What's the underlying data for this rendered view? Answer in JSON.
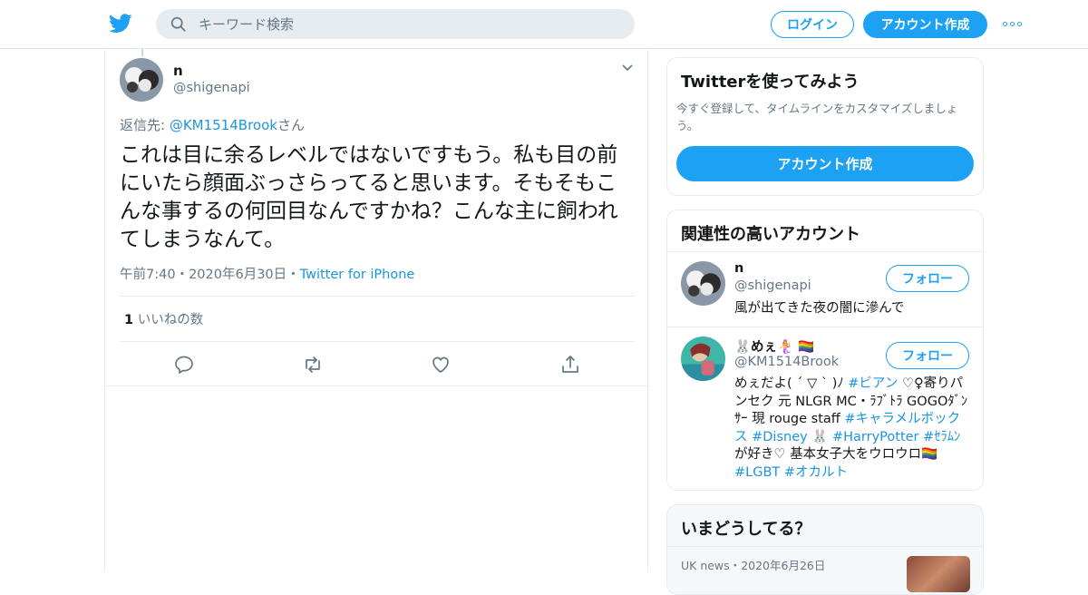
{
  "colors": {
    "accent": "#1da1f2",
    "link": "#1b95e0",
    "muted": "#657786"
  },
  "header": {
    "logo_icon": "twitter-bird-icon",
    "search_placeholder": "キーワード検索",
    "login_label": "ログイン",
    "signup_label": "アカウント作成",
    "more_icon": "more-dots-icon"
  },
  "tweet": {
    "author_name": "n",
    "author_handle": "@shigenapi",
    "reply_prefix": "返信先: ",
    "reply_handle": "@KM1514Brook",
    "reply_suffix": "さん",
    "text": "これは目に余るレベルではないですもう。私も目の前にいたら顔面ぶっさらってると思います。そもそもこんな事するの何回目なんですかね？こんな主に飼われてしまうなんて。",
    "time": "午前7:40",
    "date": "2020年6月30日",
    "source": "Twitter for iPhone",
    "separator": "・",
    "like_count": "1",
    "like_label": "いいねの数"
  },
  "signup_card": {
    "title": "Twitterを使ってみよう",
    "description": "今すぐ登録して、タイムラインをカスタマイズしましょう。",
    "button_label": "アカウント作成"
  },
  "related_card": {
    "title": "関連性の高いアカウント",
    "accounts": [
      {
        "name": "n",
        "handle": "@shigenapi",
        "follow_label": "フォロー",
        "bio": "風が出てきた夜の闇に滲んで"
      },
      {
        "name": "🐰めぇ🧜‍♀️ 🏳️‍🌈",
        "handle": "@KM1514Brook",
        "follow_label": "フォロー",
        "bio_parts": [
          "めぇだよ( ´ ▽ ` )ﾉ ",
          "#ビアン",
          " ♡♀寄りパンセク 元 NLGR MC・ﾗﾌﾞﾄﾗ GOGOﾀﾞﾝｻｰ 現 rouge staff ",
          "#キャラメルボックス",
          " ",
          "#Disney",
          " 🐰 ",
          "#HarryPotter",
          " ",
          "#ｾﾗﾑﾝ",
          " が好き♡ 基本女子大をウロウロ🏳️‍🌈 ",
          "#LGBT",
          " ",
          "#オカルト"
        ]
      }
    ]
  },
  "trends_card": {
    "title": "いまどうしてる？",
    "first_item_source": "UK news",
    "first_item_date": "2020年6月26日"
  }
}
